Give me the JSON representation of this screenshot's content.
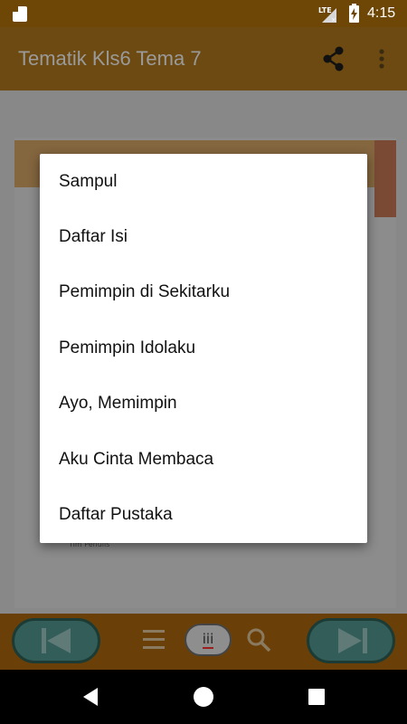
{
  "status_bar": {
    "network": "LTE",
    "time": "4:15"
  },
  "app_bar": {
    "title": "Tematik Kls6 Tema 7",
    "share_icon": "share-icon",
    "more_icon": "more-vert-icon"
  },
  "page": {
    "tim_penulis": "Tim Penulis"
  },
  "dialog": {
    "items": [
      "Sampul",
      "Daftar Isi",
      "Pemimpin di Sekitarku",
      "Pemimpin Idolaku",
      "Ayo, Memimpin",
      "Aku Cinta Membaca",
      "Daftar Pustaka"
    ]
  },
  "toolbar": {
    "prev_icon": "skip-previous-icon",
    "menu_icon": "menu-lines-icon",
    "page_number": "iii",
    "search_icon": "search-icon",
    "next_icon": "skip-next-icon"
  },
  "colors": {
    "app_bar": "#6d4a12",
    "status_bar": "#6e4606",
    "toolbar": "#6b4008",
    "nav_button": "#325d58"
  }
}
